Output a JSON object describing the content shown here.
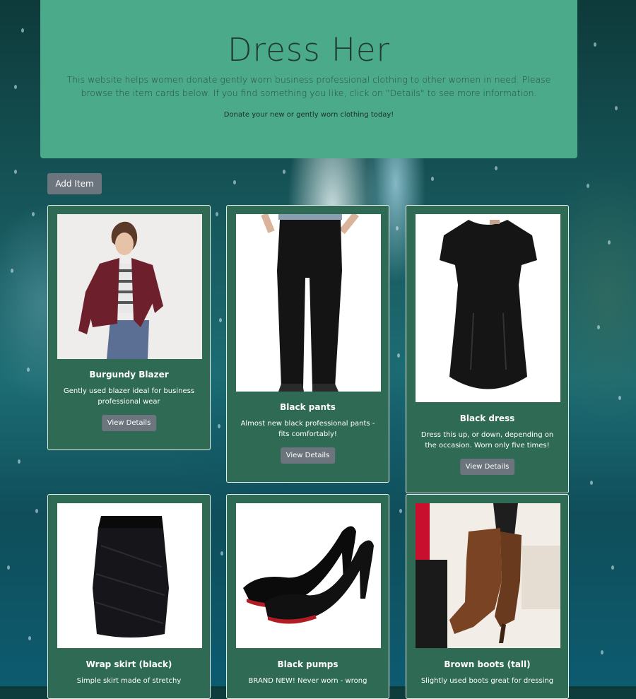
{
  "hero": {
    "title": "Dress Her",
    "lead": "This website helps women donate gently worn business professional clothing to other women in need. Please browse the item cards below. If you find something you like, click on \"Details\" to see more information.",
    "subtext": "Donate your new or gently worn clothing today!"
  },
  "actions": {
    "add_item_label": "Add Item"
  },
  "cards": [
    {
      "title": "Burgundy Blazer",
      "description": "Gently used blazer ideal for business professional wear",
      "button_label": "View Details",
      "image_icon": "blazer-image"
    },
    {
      "title": "Black pants",
      "description": "Almost new black professional pants - fits comfortably!",
      "button_label": "View Details",
      "image_icon": "pants-image"
    },
    {
      "title": "Black dress",
      "description": "Dress this up, or down, depending on the occasion. Worn only five times!",
      "button_label": "View Details",
      "image_icon": "dress-image"
    },
    {
      "title": "Wrap skirt (black)",
      "description": "Simple skirt made of stretchy",
      "image_icon": "skirt-image"
    },
    {
      "title": "Black pumps",
      "description": "BRAND NEW! Never worn - wrong",
      "image_icon": "pumps-image"
    },
    {
      "title": "Brown boots (tall)",
      "description": "Slightly used boots great for dressing",
      "image_icon": "boots-image"
    }
  ],
  "colors": {
    "hero_bg": "#4aaa8a",
    "card_bg": "#2e6a54",
    "button_bg": "#6c757d"
  }
}
